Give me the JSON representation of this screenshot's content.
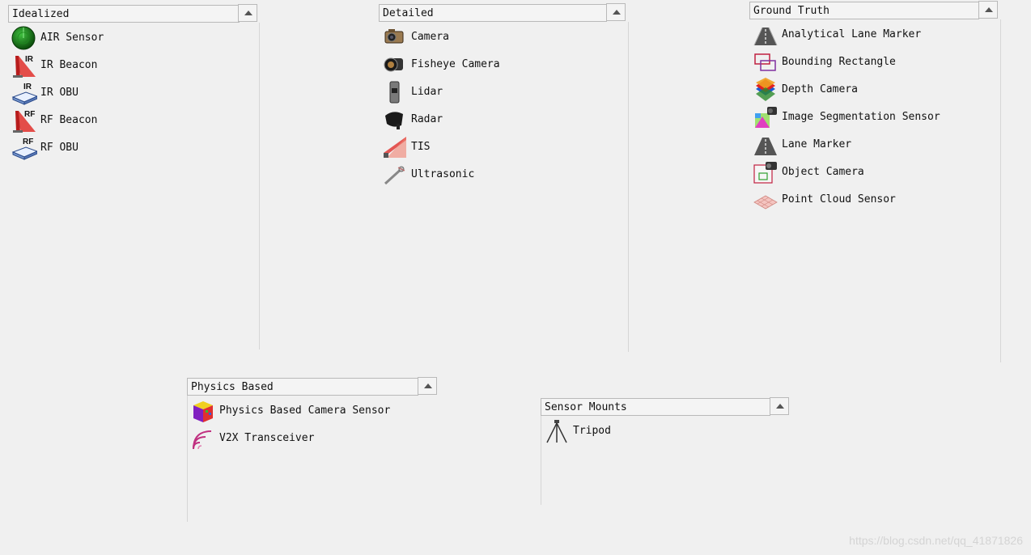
{
  "panels": {
    "idealized": {
      "title": "Idealized",
      "items": [
        {
          "label": "AIR Sensor",
          "icon": "radar-scope-icon"
        },
        {
          "label": "IR Beacon",
          "icon": "ir-beacon-icon",
          "badge": "IR"
        },
        {
          "label": "IR OBU",
          "icon": "ir-obu-icon",
          "badge": "IR"
        },
        {
          "label": "RF Beacon",
          "icon": "rf-beacon-icon",
          "badge": "RF"
        },
        {
          "label": "RF OBU",
          "icon": "rf-obu-icon",
          "badge": "RF"
        }
      ]
    },
    "detailed": {
      "title": "Detailed",
      "items": [
        {
          "label": "Camera",
          "icon": "camera-icon"
        },
        {
          "label": "Fisheye Camera",
          "icon": "fisheye-camera-icon"
        },
        {
          "label": "Lidar",
          "icon": "lidar-icon"
        },
        {
          "label": "Radar",
          "icon": "radar-icon"
        },
        {
          "label": "TIS",
          "icon": "tis-icon"
        },
        {
          "label": "Ultrasonic",
          "icon": "ultrasonic-icon"
        }
      ]
    },
    "ground_truth": {
      "title": "Ground Truth",
      "items": [
        {
          "label": "Analytical Lane Marker",
          "icon": "analytical-lane-marker-icon"
        },
        {
          "label": "Bounding Rectangle",
          "icon": "bounding-rectangle-icon"
        },
        {
          "label": "Depth Camera",
          "icon": "depth-camera-icon"
        },
        {
          "label": "Image Segmentation Sensor",
          "icon": "image-segmentation-icon"
        },
        {
          "label": "Lane Marker",
          "icon": "lane-marker-icon"
        },
        {
          "label": "Object Camera",
          "icon": "object-camera-icon"
        },
        {
          "label": "Point Cloud Sensor",
          "icon": "point-cloud-icon"
        }
      ]
    },
    "physics_based": {
      "title": "Physics Based",
      "items": [
        {
          "label": "Physics Based Camera Sensor",
          "icon": "physics-camera-cube-icon"
        },
        {
          "label": "V2X Transceiver",
          "icon": "v2x-waves-icon"
        }
      ]
    },
    "sensor_mounts": {
      "title": "Sensor Mounts",
      "items": [
        {
          "label": "Tripod",
          "icon": "tripod-icon"
        }
      ]
    }
  },
  "watermark": "https://blog.csdn.net/qq_41871826",
  "colors": {
    "background": "#f0f0f0",
    "header": "#f4f4f4",
    "border": "#b9b9b9"
  }
}
